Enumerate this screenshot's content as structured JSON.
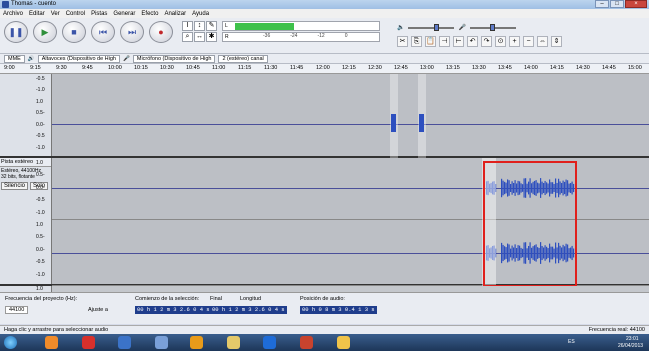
{
  "window": {
    "title": "Thomas - cuento",
    "min": "–",
    "max": "□",
    "close": "×"
  },
  "menu": [
    "Archivo",
    "Editar",
    "Ver",
    "Control",
    "Pistas",
    "Generar",
    "Efecto",
    "Analizar",
    "Ayuda"
  ],
  "transport": [
    {
      "name": "pause-button",
      "glyph": "❚❚"
    },
    {
      "name": "play-button",
      "glyph": "▶"
    },
    {
      "name": "stop-button",
      "glyph": "■"
    },
    {
      "name": "skip-start-button",
      "glyph": "⏮"
    },
    {
      "name": "skip-end-button",
      "glyph": "⏭"
    },
    {
      "name": "record-button",
      "glyph": "●"
    }
  ],
  "tools": [
    "I",
    "↕",
    "✎",
    "⌕",
    "↔",
    "✱"
  ],
  "meter": {
    "left_label": "L",
    "right_label": "R",
    "ticks": [
      "-36",
      "-24",
      "-12",
      "0"
    ],
    "level": 0.42
  },
  "mixer": {
    "ticks": [
      "-36",
      "-24",
      "-12",
      "0"
    ]
  },
  "device": {
    "host": "MME",
    "playback": "Altavoces (Dispositivo de High",
    "recording": "Micrófono (Dispositivo de High",
    "channels": "2 (estéreo) canal"
  },
  "ruler": [
    "9:00",
    "9:15",
    "9:30",
    "9:45",
    "10:00",
    "10:15",
    "10:30",
    "10:45",
    "11:00",
    "11:15",
    "11:30",
    "11:45",
    "12:00",
    "12:15",
    "12:30",
    "12:45",
    "13:00",
    "13:15",
    "13:30",
    "13:45",
    "14:00",
    "14:15",
    "14:30",
    "14:45",
    "15:00"
  ],
  "track1": {
    "scale": [
      "-0.5",
      "-1.0",
      "1.0",
      "0.5-",
      "0.0-",
      "-0.5",
      "-1.0"
    ]
  },
  "track2": {
    "name": "Pista estéreo",
    "info": [
      "Estéreo, 44100Hz",
      "32 bits, flotante"
    ],
    "mute": "Silencio",
    "solo": "Solo",
    "scale": [
      "1.0",
      "0.5-",
      "0.0-",
      "-0.5",
      "-1.0",
      "1.0",
      "0.5-",
      "0.0-",
      "-0.5",
      "-1.0"
    ]
  },
  "track3": {
    "label": "1.0"
  },
  "status": {
    "rate_label": "Frecuencia del proyecto (Hz):",
    "rate_value": "44100",
    "snap_label": "Ajuste a",
    "sel_label": "Comienzo de la selección:",
    "end_label": "Final",
    "length_label": "Longitud",
    "pos_label": "Posición de audio:",
    "sel_start": "00 h 1 2 m 3 2.6 0 4 s",
    "sel_end": "00 h 1 2 m 3 2.6 0 4 s",
    "audio_pos": "00 h 0 8 m 3 0.4 1 3 s",
    "hint": "Haga clic y arrastre para seleccionar audio",
    "actual_rate": "Frecuencia real: 44100"
  },
  "taskbar": {
    "lang": "ES",
    "time": "23:01",
    "date": "26/04/2013"
  }
}
